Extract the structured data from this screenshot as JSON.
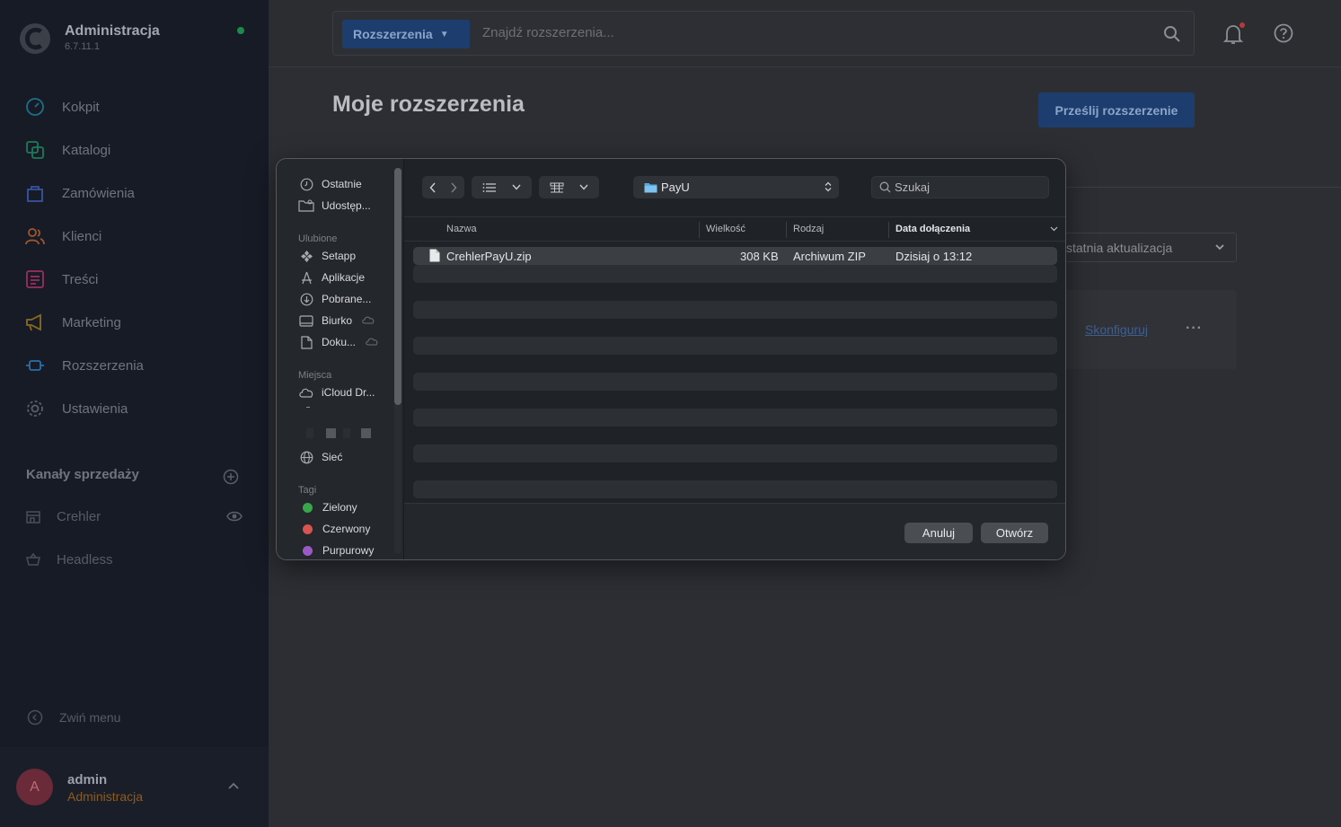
{
  "sidebar": {
    "app_title": "Administracja",
    "app_version": "6.7.11.1",
    "nav": [
      {
        "label": "Kokpit",
        "icon": "dashboard-icon",
        "color": "#1d6f8a"
      },
      {
        "label": "Katalogi",
        "icon": "catalog-icon",
        "color": "#1d7a5a"
      },
      {
        "label": "Zamówienia",
        "icon": "orders-icon",
        "color": "#3a54a0"
      },
      {
        "label": "Klienci",
        "icon": "customers-icon",
        "color": "#a0562f"
      },
      {
        "label": "Treści",
        "icon": "content-icon",
        "color": "#9b2f5e"
      },
      {
        "label": "Marketing",
        "icon": "megaphone-icon",
        "color": "#8a6a1d"
      },
      {
        "label": "Rozszerzenia",
        "icon": "extensions-icon",
        "color": "#2a6fa8"
      },
      {
        "label": "Ustawienia",
        "icon": "gear-icon",
        "color": "#5a5f66"
      }
    ],
    "sales_channels_title": "Kanały sprzedaży",
    "channels": [
      {
        "label": "Crehler",
        "icon": "storefront-icon"
      },
      {
        "label": "Headless",
        "icon": "basket-icon"
      }
    ],
    "collapse_label": "Zwiń menu",
    "user": {
      "initial": "A",
      "name": "admin",
      "role": "Administracja"
    }
  },
  "topbar": {
    "search_scope": "Rozszerzenia",
    "search_placeholder": "Znajdź rozszerzenia..."
  },
  "page": {
    "title": "Moje rozszerzenia",
    "upload_button": "Prześlij rozszerzenie",
    "sort_label": "statnia aktualizacja",
    "configure_link": "Skonfiguruj",
    "more_dots": "···"
  },
  "dialog": {
    "sidebar": {
      "items_top": [
        {
          "label": "Ostatnie",
          "icon": "clock-icon"
        },
        {
          "label": "Udostęp...",
          "icon": "shared-folder-icon"
        }
      ],
      "favorites_title": "Ulubione",
      "favorites": [
        {
          "label": "Setapp",
          "icon": "setapp-icon"
        },
        {
          "label": "Aplikacje",
          "icon": "applications-icon"
        },
        {
          "label": "Pobrane...",
          "icon": "download-icon"
        },
        {
          "label": "Biurko",
          "icon": "desktop-icon"
        },
        {
          "label": "Doku...",
          "icon": "document-icon"
        }
      ],
      "places_title": "Miejsca",
      "places": [
        {
          "label": "iCloud Dr...",
          "icon": "icloud-icon"
        },
        {
          "label": "Sieć",
          "icon": "network-icon"
        }
      ],
      "tags_title": "Tagi",
      "tags": [
        {
          "label": "Zielony",
          "color": "#3aa64a"
        },
        {
          "label": "Czerwony",
          "color": "#d9534f"
        },
        {
          "label": "Purpurowy",
          "color": "#9b59c6"
        }
      ]
    },
    "toolbar": {
      "folder": "PayU",
      "search_placeholder": "Szukaj"
    },
    "columns": {
      "name": "Nazwa",
      "size": "Wielkość",
      "kind": "Rodzaj",
      "date": "Data dołączenia"
    },
    "files": [
      {
        "name": "CrehlerPayU.zip",
        "size": "308 KB",
        "kind": "Archiwum ZIP",
        "date": "Dzisiaj o 13:12"
      }
    ],
    "cancel_button": "Anuluj",
    "open_button": "Otwórz"
  }
}
